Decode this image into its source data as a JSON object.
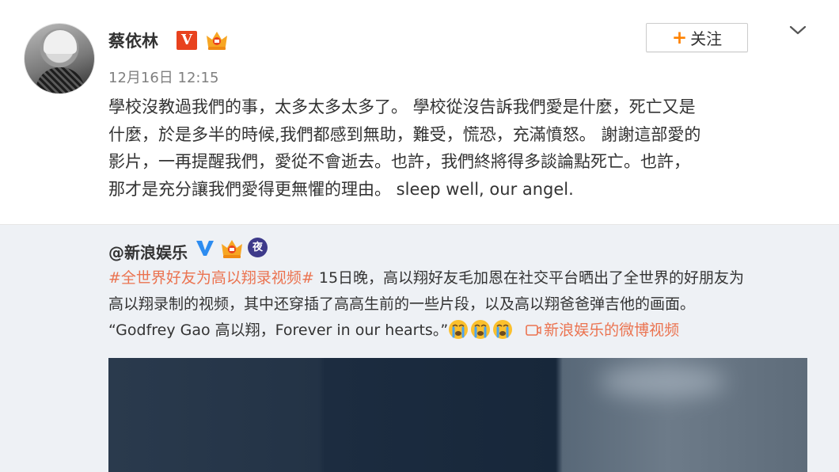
{
  "post": {
    "username": "蔡依林",
    "verified_badge": "V",
    "timestamp": "12月16日 12:15",
    "follow_label": "关注",
    "follow_plus": "+",
    "text_lines": [
      "學校沒教過我們的事，太多太多太多了。 學校從沒告訴我們愛是什麼，死亡又是",
      "什麼，於是多半的時候,我們都感到無助，難受，慌恐，充滿憤怒。 謝謝這部愛的",
      "影片，一再提醒我們，愛從不會逝去。也許，我們終將得多談論點死亡。也許，",
      "那才是充分讓我們愛得更無懼的理由。 sleep well, our angel."
    ]
  },
  "repost": {
    "author": "@新浪娱乐",
    "night_badge": "夜",
    "hashtag": "#全世界好友为高以翔录视频#",
    "line1_rest": " 15日晚，高以翔好友毛加恩在社交平台晒出了全世界的好朋友为",
    "line2": "高以翔录制的视频，其中还穿插了高高生前的一些片段，以及高以翔爸爸弹吉他的画面。",
    "line3_text": "“Godfrey Gao 高以翔，Forever in our hearts。”",
    "video_link": "新浪娱乐的微博视频"
  },
  "colors": {
    "accent": "#eb7350",
    "follow_plus": "#ff8200",
    "badge_red": "#e8421e",
    "repost_bg": "#eef1f5"
  },
  "icons": [
    "crown-badge-icon",
    "chevron-down-icon",
    "verified-v-icon",
    "crying-emoji-icon",
    "video-icon"
  ]
}
